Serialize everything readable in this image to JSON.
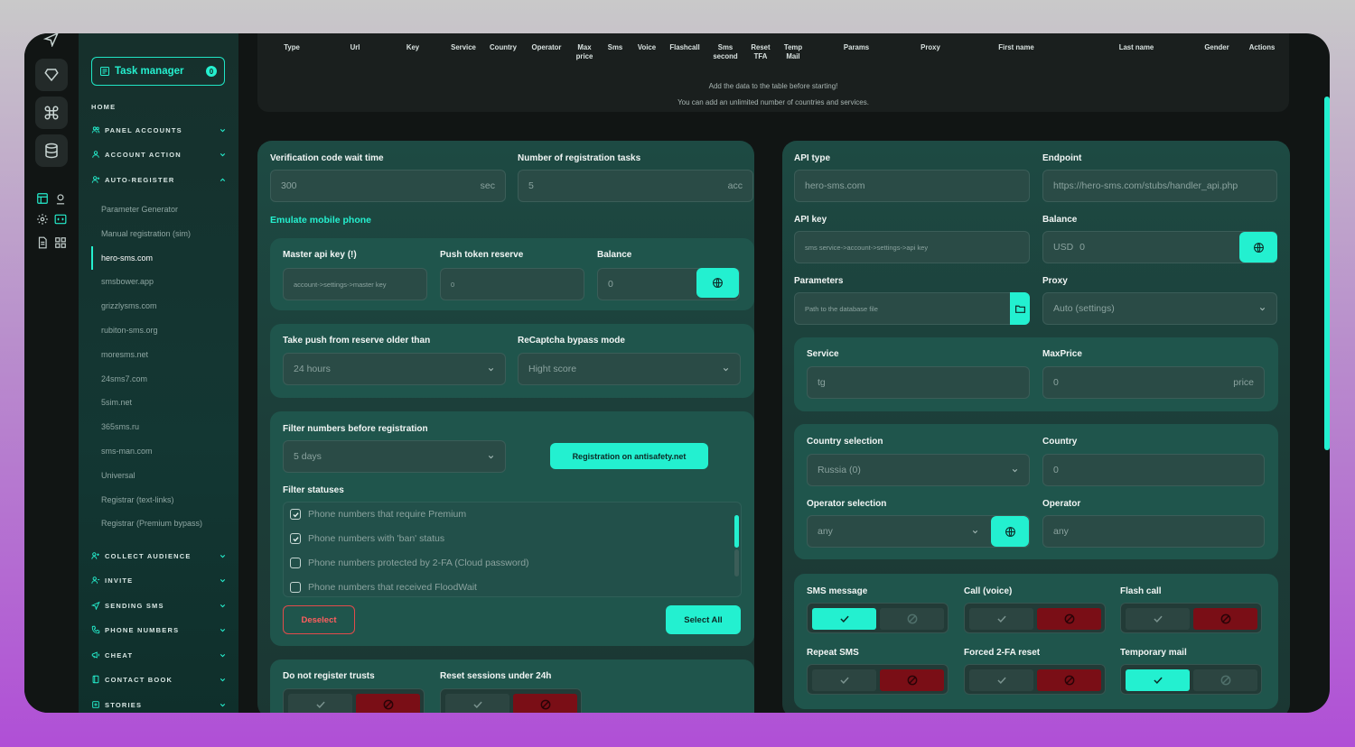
{
  "sidebar": {
    "task_manager": {
      "label": "Task manager",
      "count": "0"
    },
    "home": "HOME",
    "sections_top": [
      {
        "label": "PANEL ACCOUNTS",
        "icon": "users-icon"
      },
      {
        "label": "ACCOUNT ACTION",
        "icon": "user-icon"
      },
      {
        "label": "AUTO-REGISTER",
        "icon": "user-add-icon",
        "expanded": true
      }
    ],
    "sub_items": [
      "Parameter Generator",
      "Manual registration (sim)",
      "hero-sms.com",
      "smsbower.app",
      "grizzlysms.com",
      "rubiton-sms.org",
      "moresms.net",
      "24sms7.com",
      "5sim.net",
      "365sms.ru",
      "sms-man.com",
      "Universal",
      "Registrar (text-links)",
      "Registrar (Premium bypass)"
    ],
    "active_sub": "hero-sms.com",
    "sections_bottom": [
      {
        "label": "COLLECT AUDIENCE",
        "icon": "users-add-icon"
      },
      {
        "label": "INVITE",
        "icon": "user-invite-icon"
      },
      {
        "label": "SENDING SMS",
        "icon": "send-icon"
      },
      {
        "label": "PHONE NUMBERS",
        "icon": "phone-icon"
      },
      {
        "label": "CHEAT",
        "icon": "megaphone-icon"
      },
      {
        "label": "CONTACT BOOK",
        "icon": "book-icon"
      },
      {
        "label": "STORIES",
        "icon": "stories-icon"
      }
    ]
  },
  "table": {
    "headers": [
      "Type",
      "Url",
      "Key",
      "Service",
      "Country",
      "Operator",
      "Max price",
      "Sms",
      "Voice",
      "Flashcall",
      "Sms second",
      "Reset TFA",
      "Temp Mail",
      "Params",
      "Proxy",
      "First name",
      "Last name",
      "Gender",
      "Actions"
    ],
    "empty_line1": "Add the data to the table before starting!",
    "empty_line2": "You can add an unlimited number of countries and services."
  },
  "left": {
    "wait_time": {
      "label": "Verification code wait time",
      "value": "300",
      "suffix": "sec"
    },
    "tasks": {
      "label": "Number of registration tasks",
      "value": "5",
      "suffix": "acc"
    },
    "emulate": "Emulate mobile phone",
    "master_key": {
      "label": "Master api key (!)",
      "placeholder": "account->settings->master key"
    },
    "push_reserve": {
      "label": "Push token reserve",
      "value": "0"
    },
    "balance": {
      "label": "Balance",
      "value": "0"
    },
    "push_older": {
      "label": "Take push from reserve older than",
      "value": "24 hours"
    },
    "recaptcha": {
      "label": "ReCaptcha bypass mode",
      "value": "Hight score"
    },
    "filter_numbers": {
      "label": "Filter numbers before registration",
      "value": "5 days"
    },
    "antisafety_button": "Registration on antisafety.net",
    "filter_statuses": {
      "label": "Filter statuses",
      "items": [
        {
          "text": "Phone numbers that require Premium",
          "checked": true
        },
        {
          "text": "Phone numbers with 'ban' status",
          "checked": true
        },
        {
          "text": "Phone numbers protected by 2-FA (Cloud password)",
          "checked": false
        },
        {
          "text": "Phone numbers that received FloodWait",
          "checked": false
        }
      ]
    },
    "deselect": "Deselect",
    "select_all": "Select All",
    "no_trusts": "Do not register trusts",
    "reset_sessions": "Reset sessions under 24h"
  },
  "right": {
    "api_type": {
      "label": "API type",
      "value": "hero-sms.com"
    },
    "endpoint": {
      "label": "Endpoint",
      "value": "https://hero-sms.com/stubs/handler_api.php"
    },
    "api_key": {
      "label": "API key",
      "placeholder": "sms service->account->settings->api key"
    },
    "balance": {
      "label": "Balance",
      "currency": "USD",
      "value": "0"
    },
    "parameters": {
      "label": "Parameters",
      "placeholder": "Path to the database file"
    },
    "proxy": {
      "label": "Proxy",
      "value": "Auto (settings)"
    },
    "service": {
      "label": "Service",
      "value": "tg"
    },
    "max_price": {
      "label": "MaxPrice",
      "value": "0",
      "suffix": "price"
    },
    "country_sel": {
      "label": "Country selection",
      "value": "Russia (0)"
    },
    "country": {
      "label": "Country",
      "value": "0"
    },
    "operator_sel": {
      "label": "Operator selection",
      "value": "any"
    },
    "operator": {
      "label": "Operator",
      "value": "any"
    },
    "toggles": [
      {
        "label": "SMS message",
        "state": "yes"
      },
      {
        "label": "Call (voice)",
        "state": "no"
      },
      {
        "label": "Flash call",
        "state": "no"
      },
      {
        "label": "Repeat SMS",
        "state": "no"
      },
      {
        "label": "Forced 2-FA reset",
        "state": "no"
      },
      {
        "label": "Temporary mail",
        "state": "yes"
      }
    ]
  },
  "colors": {
    "accent": "#23f0d0",
    "danger": "#7a0e16",
    "panel": "#1d4a43",
    "bg": "#111514"
  }
}
